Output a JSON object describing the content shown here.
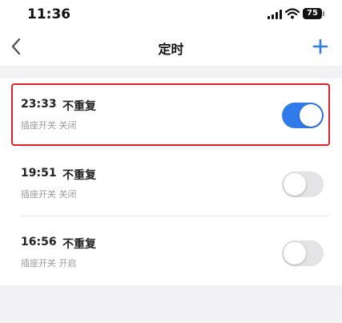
{
  "status_bar": {
    "time": "11:36",
    "battery": "75"
  },
  "nav": {
    "title": "定时",
    "back_icon": "chevron-left-icon",
    "add_icon": "plus-icon"
  },
  "timers": [
    {
      "time": "23:33",
      "repeat": "不重复",
      "desc": "插座开关 关闭",
      "enabled": true
    },
    {
      "time": "19:51",
      "repeat": "不重复",
      "desc": "插座开关 关闭",
      "enabled": false
    },
    {
      "time": "16:56",
      "repeat": "不重复",
      "desc": "插座开关 开启",
      "enabled": false
    }
  ],
  "colors": {
    "accent": "#2f7bec",
    "highlight": "#e0202a"
  }
}
